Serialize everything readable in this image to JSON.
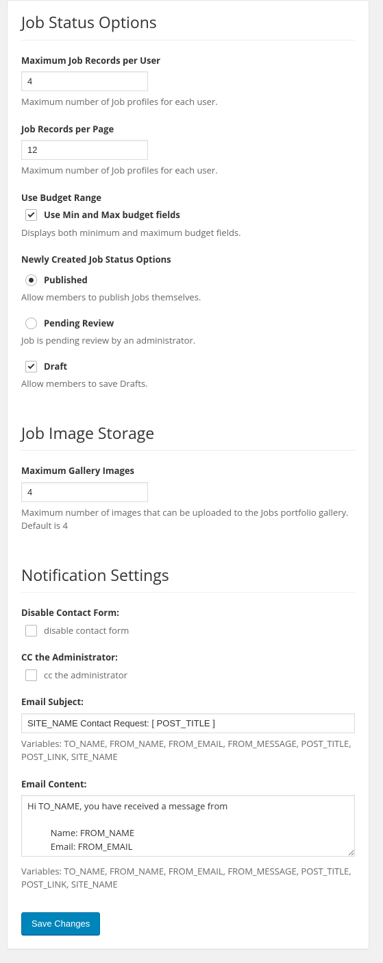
{
  "sections": {
    "jobStatus": {
      "title": "Job Status Options",
      "maxRecords": {
        "label": "Maximum Job Records per User",
        "value": "4",
        "desc": "Maximum number of Job profiles for each user."
      },
      "perPage": {
        "label": "Job Records per Page",
        "value": "12",
        "desc": "Maximum number of Job profiles for each user."
      },
      "budget": {
        "label": "Use Budget Range",
        "optionLabel": "Use Min and Max budget fields",
        "desc": "Displays both minimum and maximum budget fields."
      },
      "newStatus": {
        "label": "Newly Created Job Status Options",
        "published": {
          "label": "Published",
          "desc": "Allow members to publish Jobs themselves."
        },
        "pending": {
          "label": "Pending Review",
          "desc": "Job is pending review by an administrator."
        },
        "draft": {
          "label": "Draft",
          "desc": "Allow members to save Drafts."
        }
      }
    },
    "imageStorage": {
      "title": "Job Image Storage",
      "maxGallery": {
        "label": "Maximum Gallery Images",
        "value": "4",
        "desc": "Maximum number of images that can be uploaded to the Jobs portfolio gallery. Default is 4"
      }
    },
    "notifications": {
      "title": "Notification Settings",
      "disableForm": {
        "label": "Disable Contact Form:",
        "optionLabel": "disable contact form"
      },
      "ccAdmin": {
        "label": "CC the Administrator:",
        "optionLabel": "cc the administrator"
      },
      "emailSubject": {
        "label": "Email Subject:",
        "value": "SITE_NAME Contact Request: [ POST_TITLE ]",
        "desc": "Variables: TO_NAME, FROM_NAME, FROM_EMAIL, FROM_MESSAGE, POST_TITLE, POST_LINK, SITE_NAME"
      },
      "emailContent": {
        "label": "Email Content:",
        "value": "Hi TO_NAME, you have received a message from\n\n          Name: FROM_NAME\n          Email: FROM_EMAIL\n          Message:",
        "desc": "Variables: TO_NAME, FROM_NAME, FROM_EMAIL, FROM_MESSAGE, POST_TITLE, POST_LINK, SITE_NAME"
      }
    }
  },
  "actions": {
    "save": "Save Changes"
  }
}
